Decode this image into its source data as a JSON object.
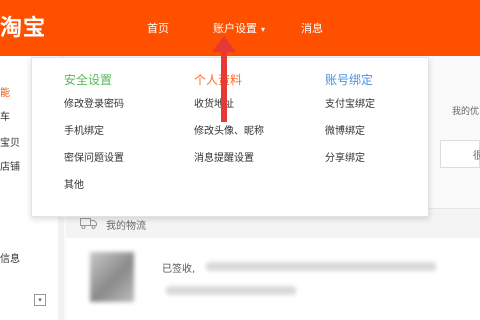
{
  "header": {
    "logo_text": "淘宝",
    "nav": [
      {
        "label": "首页"
      },
      {
        "label": "账户设置",
        "has_dropdown": true,
        "arrow": "▾"
      },
      {
        "label": "消息"
      }
    ]
  },
  "dropdown": {
    "columns": [
      {
        "title": "安全设置",
        "title_color": "#5cb85c",
        "items": [
          "修改登录密码",
          "手机绑定",
          "密保问题设置",
          "其他"
        ]
      },
      {
        "title": "个人资料",
        "title_color": "#ff6a2b",
        "items": [
          "收货地址",
          "修改头像、昵称",
          "消息提醒设置"
        ]
      },
      {
        "title": "账号绑定",
        "title_color": "#4a90e2",
        "items": [
          "支付宝绑定",
          "微博绑定",
          "分享绑定"
        ]
      }
    ]
  },
  "left_panel": {
    "items": [
      "能",
      "车",
      "宝贝",
      "店铺",
      "信息"
    ],
    "toggle_icon": "▾"
  },
  "main": {
    "right_tab": "我的优",
    "right_input_text": "很",
    "logistics_title": "我的物流",
    "status_text": "已签收,"
  },
  "colors": {
    "brand": "#ff5000",
    "annotation": "#e53935"
  },
  "icons": {
    "truck": "truck-icon",
    "arrow_annotation": "up-arrow-annotation"
  }
}
